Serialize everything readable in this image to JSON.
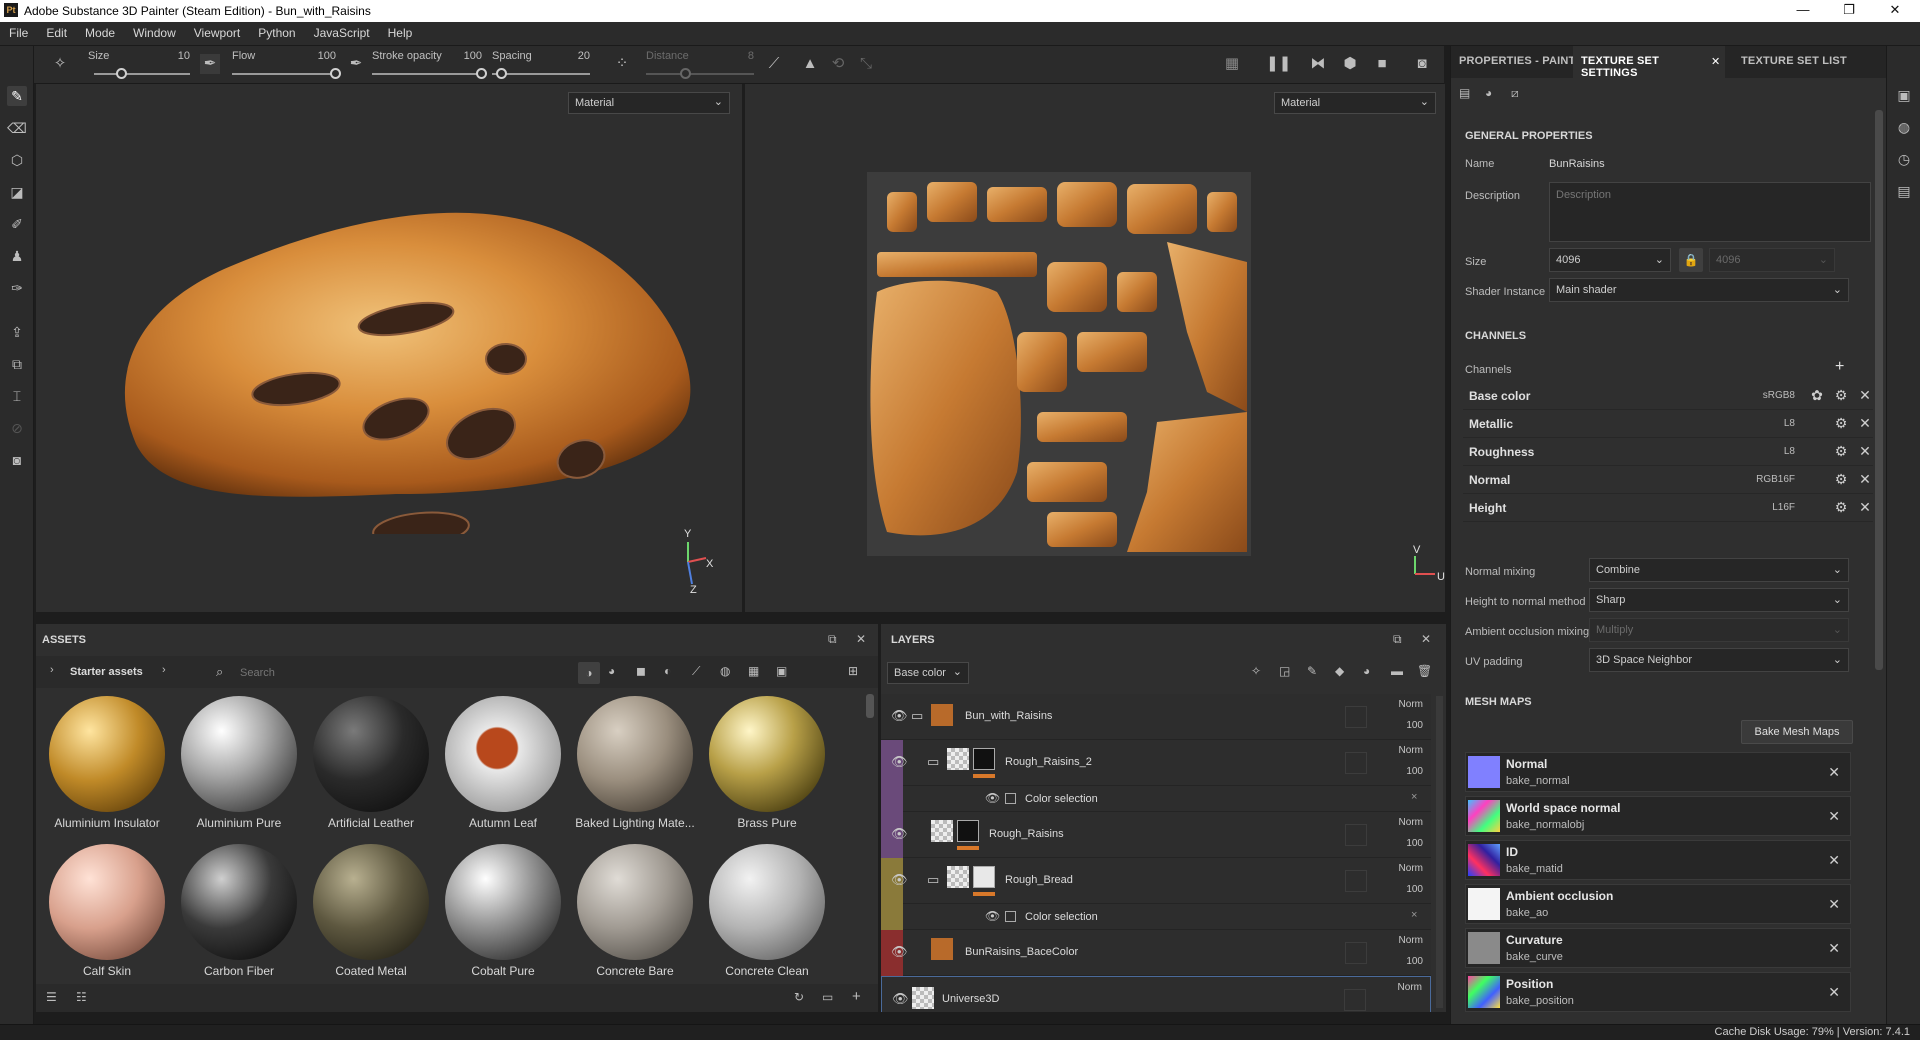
{
  "window": {
    "title": "Adobe Substance 3D Painter (Steam Edition) - Bun_with_Raisins",
    "logo": "Pt"
  },
  "menu": [
    "File",
    "Edit",
    "Mode",
    "Window",
    "Viewport",
    "Python",
    "JavaScript",
    "Help"
  ],
  "toolbar": {
    "size_label": "Size",
    "size_value": "10",
    "flow_label": "Flow",
    "flow_value": "100",
    "stroke_label": "Stroke opacity",
    "stroke_value": "100",
    "spacing_label": "Spacing",
    "spacing_value": "20",
    "distance_label": "Distance",
    "distance_value": "8"
  },
  "viewport3d": {
    "mode": "Material",
    "axis_y": "Y",
    "axis_x": "X",
    "axis_z": "Z"
  },
  "viewport2d": {
    "mode": "Material",
    "axis_v": "V",
    "axis_u": "U"
  },
  "right_tabs": [
    {
      "label": "PROPERTIES - PAINT"
    },
    {
      "label": "TEXTURE SET SETTINGS",
      "close": "✕"
    },
    {
      "label": "TEXTURE SET LIST"
    }
  ],
  "general": {
    "heading": "GENERAL PROPERTIES",
    "name_label": "Name",
    "name_value": "BunRaisins",
    "desc_label": "Description",
    "desc_placeholder": "Description",
    "size_label": "Size",
    "size_value": "4096",
    "size_value2": "4096",
    "shader_label": "Shader Instance",
    "shader_value": "Main shader"
  },
  "channels": {
    "heading": "CHANNELS",
    "list_label": "Channels",
    "add": "+",
    "items": [
      {
        "name": "Base color",
        "format": "sRGB8"
      },
      {
        "name": "Metallic",
        "format": "L8"
      },
      {
        "name": "Roughness",
        "format": "L8"
      },
      {
        "name": "Normal",
        "format": "RGB16F"
      },
      {
        "name": "Height",
        "format": "L16F"
      }
    ]
  },
  "mixing": {
    "normal_label": "Normal mixing",
    "normal_value": "Combine",
    "h2n_label": "Height to normal method",
    "h2n_value": "Sharp",
    "ao_label": "Ambient occlusion mixing",
    "ao_value": "Multiply",
    "uv_label": "UV padding",
    "uv_value": "3D Space Neighbor"
  },
  "mesh_maps": {
    "heading": "MESH MAPS",
    "bake_button": "Bake Mesh Maps",
    "items": [
      {
        "title": "Normal",
        "sub": "bake_normal"
      },
      {
        "title": "World space normal",
        "sub": "bake_normalobj"
      },
      {
        "title": "ID",
        "sub": "bake_matid"
      },
      {
        "title": "Ambient occlusion",
        "sub": "bake_ao"
      },
      {
        "title": "Curvature",
        "sub": "bake_curve"
      },
      {
        "title": "Position",
        "sub": "bake_position"
      }
    ]
  },
  "assets": {
    "title": "ASSETS",
    "breadcrumb": "Starter assets",
    "search_placeholder": "Search",
    "items": [
      {
        "label": "Aluminium Insulator"
      },
      {
        "label": "Aluminium Pure"
      },
      {
        "label": "Artificial Leather"
      },
      {
        "label": "Autumn Leaf"
      },
      {
        "label": "Baked Lighting Mate..."
      },
      {
        "label": "Brass Pure"
      },
      {
        "label": "Calf Skin"
      },
      {
        "label": "Carbon Fiber"
      },
      {
        "label": "Coated Metal"
      },
      {
        "label": "Cobalt Pure"
      },
      {
        "label": "Concrete Bare"
      },
      {
        "label": "Concrete Clean"
      }
    ]
  },
  "layers": {
    "title": "LAYERS",
    "channel_select": "Base color",
    "rows": [
      {
        "name": "Bun_with_Raisins",
        "blend": "Norm",
        "opacity": "100"
      },
      {
        "name": "Rough_Raisins_2",
        "blend": "Norm",
        "opacity": "100"
      },
      {
        "name": "Color selection"
      },
      {
        "name": "Rough_Raisins",
        "blend": "Norm",
        "opacity": "100"
      },
      {
        "name": "Rough_Bread",
        "blend": "Norm",
        "opacity": "100"
      },
      {
        "name": "Color selection"
      },
      {
        "name": "BunRaisins_BaceColor",
        "blend": "Norm",
        "opacity": "100"
      },
      {
        "name": "Universe3D",
        "blend": "Norm"
      }
    ]
  },
  "status": {
    "text": "Cache Disk Usage:  79% | Version: 7.4.1"
  }
}
